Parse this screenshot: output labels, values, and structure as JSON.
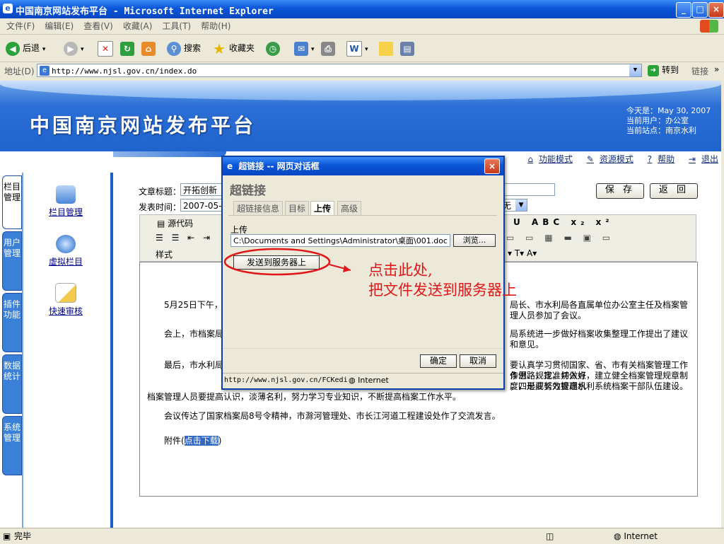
{
  "window": {
    "title": "中国南京网站发布平台 - Microsoft Internet Explorer",
    "minimize": "_",
    "maximize": "□",
    "close": "×"
  },
  "menu": [
    "文件(F)",
    "编辑(E)",
    "查看(V)",
    "收藏(A)",
    "工具(T)",
    "帮助(H)"
  ],
  "toolbar": {
    "back": "后退",
    "search": "搜索",
    "favorites": "收藏夹"
  },
  "address": {
    "label": "地址(D)",
    "url": "http://www.njsl.gov.cn/index.do",
    "go": "转到",
    "links": "链接"
  },
  "site": {
    "title": "中国南京网站发布平台",
    "today": "今天是：May 30, 2007",
    "current_user": "当前用户：办公室",
    "current_site": "当前站点：南京水利",
    "nav": [
      "功能模式",
      "资源模式",
      "帮助",
      "退出"
    ]
  },
  "side_tabs": [
    "栏目管理",
    "用户管理",
    "插件功能",
    "数据统计",
    "系统管理"
  ],
  "side_items": [
    "栏目管理",
    "虚拟栏目",
    "快速审核"
  ],
  "form": {
    "article_title_label": "文章标题：",
    "article_title_value": "开拓创新",
    "publish_time_label": "发表时间：",
    "publish_time_value": "2007-05-",
    "select_value": "无",
    "save": "保 存",
    "back": "返 回"
  },
  "editor": {
    "source_code": "源代码",
    "style_label": "样式",
    "paragraphs": [
      "5月25日下午，",
      "局长、市水利局各直属单位办公室主任及档案管理人员参加了会议。",
      "会上，市档案局",
      "局系统进一步做好档案收集整理工作提出了建议和意见。",
      "最后，市水利局",
      "要认真学习贯彻国家、省、市有关档案管理工作条例、规定，并做好",
      "作思路，找准切入点，建立健全档案管理规章制度，形成长效管理机",
      "；四是要努力提高水利系统档案干部队伍建设。",
      "档案管理人员要提高认识，淡薄名利，努力学习专业知识，不断提高档案工作水平。",
      "会议传达了国家档案局8号令精神，市滁河管理处、市长江河道工程建设处作了交流发言。"
    ],
    "attachment_prefix": "附件(",
    "attachment_link": "点击下载",
    "attachment_suffix": ")"
  },
  "dialog": {
    "title": "超链接 -- 网页对话框",
    "heading": "超链接",
    "tabs": [
      "超链接信息",
      "目标",
      "上传",
      "高级"
    ],
    "upload_label": "上传",
    "file_path": "C:\\Documents and Settings\\Administrator\\桌面\\001.doc",
    "browse": "浏览...",
    "send_button": "发送到服务器上",
    "ok": "确定",
    "cancel": "取消",
    "status_url": "http://www.njsl.gov.cn/FCKedi",
    "status_zone": "Internet"
  },
  "annotation": {
    "line1": "点击此处,",
    "line2": "把文件发送到服务器上",
    "color": "#e0161a"
  },
  "statusbar": {
    "text": "完毕",
    "zone": "Internet"
  }
}
